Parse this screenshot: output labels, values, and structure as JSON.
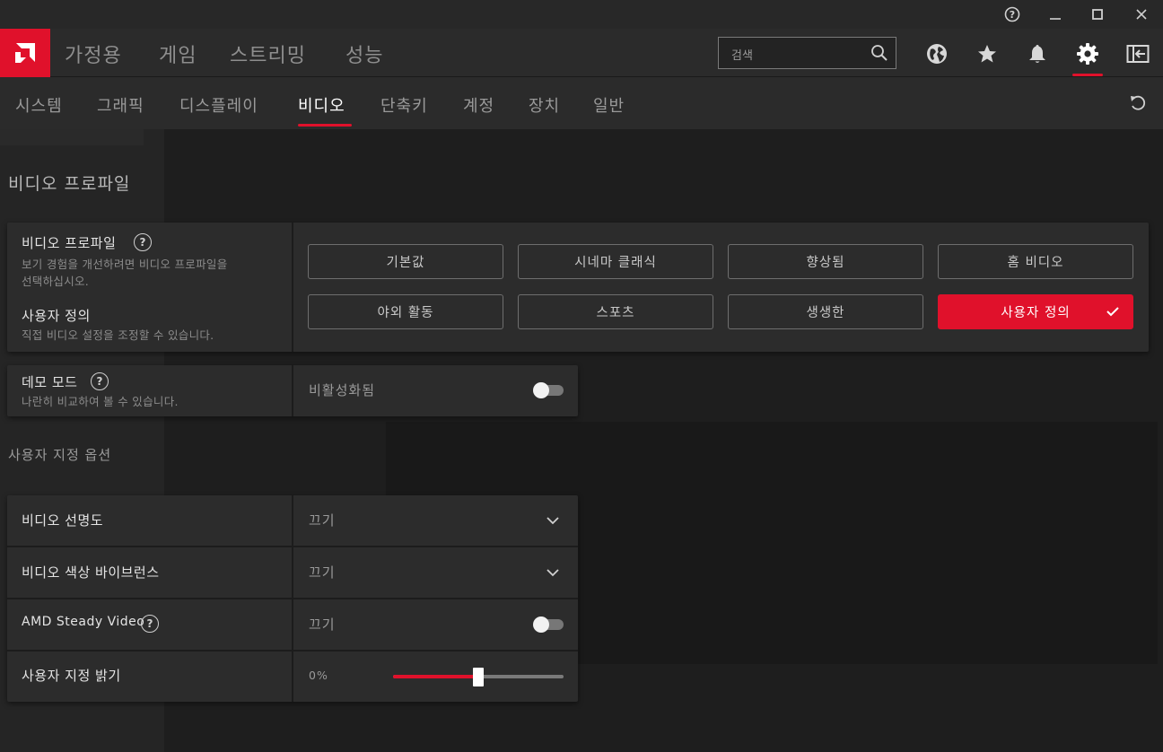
{
  "window_controls": {
    "help": "?",
    "minimize": "minimize",
    "maximize": "maximize",
    "close": "close"
  },
  "top_nav": {
    "items": [
      "가정용",
      "게임",
      "스트리밍",
      "성능"
    ],
    "search_placeholder": "검색",
    "icons": [
      "globe-icon",
      "star-icon",
      "bell-icon",
      "gear-icon",
      "sidebar-collapse-icon"
    ],
    "active_icon": "gear-icon"
  },
  "sub_nav": {
    "items": [
      "시스템",
      "그래픽",
      "디스플레이",
      "비디오",
      "단축키",
      "계정",
      "장치",
      "일반"
    ],
    "active": "비디오",
    "reset_icon": "reset-icon"
  },
  "video_profile_section": {
    "title": "비디오 프로파일",
    "card": {
      "label": "비디오 프로파일",
      "description_line1": "보기 경험을 개선하려면 비디오 프로파일을",
      "description_line2": "선택하십시오.",
      "current_label": "사용자 정의",
      "current_description": "직접 비디오 설정을 조정할 수 있습니다.",
      "presets": [
        "기본값",
        "시네마 클래식",
        "향상됨",
        "홈 비디오",
        "야외 활동",
        "스포츠",
        "생생한",
        "사용자 정의"
      ],
      "selected_preset": "사용자 정의"
    }
  },
  "demo_mode": {
    "label": "데모 모드",
    "description": "나란히 비교하여 볼 수 있습니다.",
    "value": "비활성화됨",
    "enabled": false
  },
  "custom_options": {
    "title": "사용자 지정 옵션",
    "rows": [
      {
        "label": "비디오 선명도",
        "value": "끄기",
        "control": "dropdown"
      },
      {
        "label": "비디오 색상 바이브런스",
        "value": "끄기",
        "control": "dropdown"
      },
      {
        "label": "AMD Steady Video",
        "value": "끄기",
        "control": "toggle",
        "enabled": false
      },
      {
        "label": "사용자 지정 밝기",
        "value": "0%",
        "control": "slider",
        "slider_fraction": 0.5
      }
    ]
  },
  "colors": {
    "accent": "#e0112b",
    "panel": "#2c2c2c",
    "background": "#1c1c1c"
  }
}
